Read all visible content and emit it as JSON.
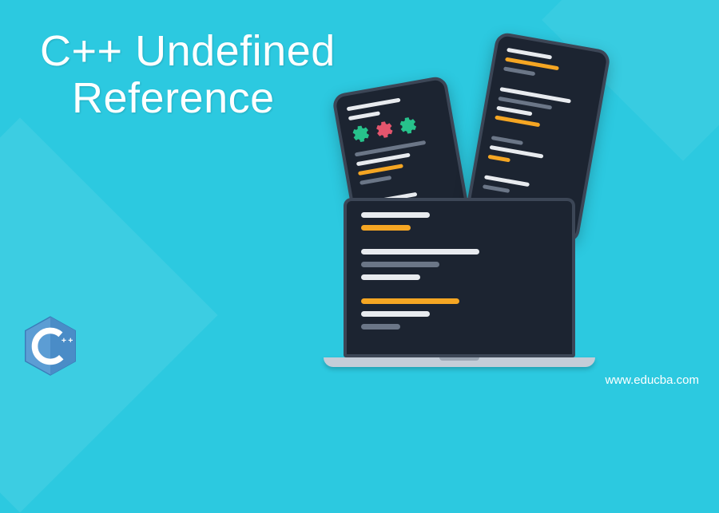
{
  "title_line1": "C++ Undefined",
  "title_line2": "Reference",
  "website": "www.educba.com",
  "logo_text": "C++",
  "colors": {
    "background": "#2cc9e0",
    "device_body": "#1c2431",
    "device_border": "#3c4656",
    "code_white": "#e8ebef",
    "code_orange": "#f5a623",
    "code_grey": "#6b7687",
    "gear_green": "#27c28b",
    "gear_red": "#e4556d",
    "logo_blue": "#5c9dd4"
  }
}
